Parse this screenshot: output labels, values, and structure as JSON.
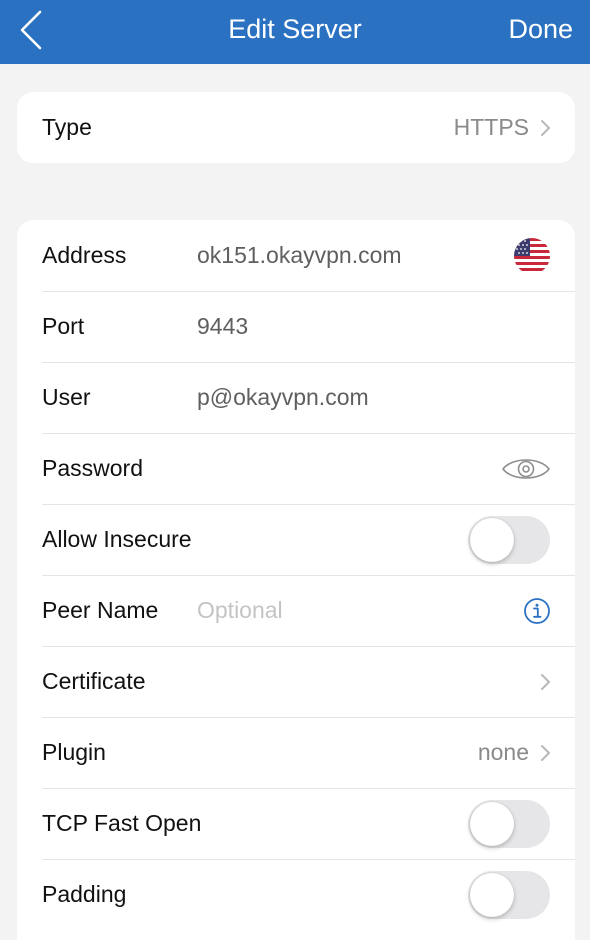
{
  "nav": {
    "title": "Edit Server",
    "back_icon": "chevron-left-icon",
    "done_label": "Done"
  },
  "colors": {
    "nav_background": "#2a72c1",
    "info_icon": "#2a72c1",
    "toggle_off": "#e6e6e9"
  },
  "type_section": {
    "label": "Type",
    "value": "HTTPS"
  },
  "server": {
    "address": {
      "label": "Address",
      "value": "ok151.okayvpn.com",
      "flag_icon": "us-flag-icon"
    },
    "port": {
      "label": "Port",
      "value": "9443"
    },
    "user": {
      "label": "User",
      "value": "p@okayvpn.com"
    },
    "password": {
      "label": "Password",
      "value": "",
      "icon": "eye-icon"
    },
    "allow_insecure": {
      "label": "Allow Insecure",
      "enabled": false
    },
    "peer_name": {
      "label": "Peer Name",
      "placeholder": "Optional",
      "value": "",
      "icon": "info-icon"
    },
    "certificate": {
      "label": "Certificate"
    },
    "plugin": {
      "label": "Plugin",
      "value": "none"
    },
    "tcp_fast_open": {
      "label": "TCP Fast Open",
      "enabled": false
    },
    "padding": {
      "label": "Padding",
      "enabled": false
    }
  }
}
